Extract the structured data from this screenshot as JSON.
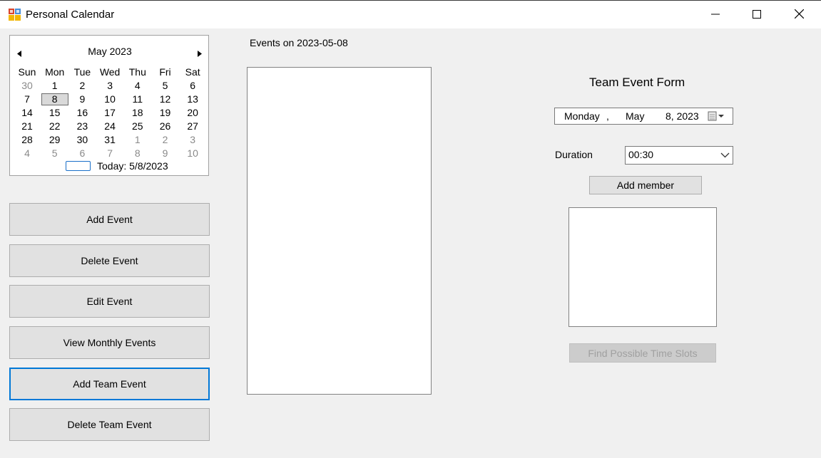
{
  "window": {
    "title": "Personal Calendar",
    "icons": {
      "app": "calendar-app-icon",
      "minimize": "minimize-icon",
      "maximize": "maximize-icon",
      "close": "close-icon"
    }
  },
  "calendar": {
    "month_label": "May 2023",
    "weekdays": [
      "Sun",
      "Mon",
      "Tue",
      "Wed",
      "Thu",
      "Fri",
      "Sat"
    ],
    "weeks": [
      [
        "30",
        "1",
        "2",
        "3",
        "4",
        "5",
        "6"
      ],
      [
        "7",
        "8",
        "9",
        "10",
        "11",
        "12",
        "13"
      ],
      [
        "14",
        "15",
        "16",
        "17",
        "18",
        "19",
        "20"
      ],
      [
        "21",
        "22",
        "23",
        "24",
        "25",
        "26",
        "27"
      ],
      [
        "28",
        "29",
        "30",
        "31",
        "1",
        "2",
        "3"
      ],
      [
        "4",
        "5",
        "6",
        "7",
        "8",
        "9",
        "10"
      ]
    ],
    "today_label": "Today: 5/8/2023",
    "today_box_color": "#1a6fc9"
  },
  "sidebar": {
    "buttons": [
      {
        "label": "Add Event",
        "name": "add-event-button"
      },
      {
        "label": "Delete Event",
        "name": "delete-event-button"
      },
      {
        "label": "Edit Event",
        "name": "edit-event-button"
      },
      {
        "label": "View Monthly Events",
        "name": "view-monthly-events-button"
      },
      {
        "label": "Add Team Event",
        "name": "add-team-event-button"
      },
      {
        "label": "Delete Team Event",
        "name": "delete-team-event-button"
      }
    ],
    "focus_color": "#0078d7"
  },
  "events": {
    "label": "Events on 2023-05-08"
  },
  "team_form": {
    "title": "Team Event Form",
    "date_picker": {
      "weekday": "Monday",
      "separator": ",",
      "month": "May",
      "day_year": "8, 2023",
      "icon": "calendar-dropdown-icon"
    },
    "duration_label": "Duration",
    "duration_value": "00:30",
    "add_member_label": "Add member",
    "find_slots_label": "Find Possible Time Slots"
  }
}
